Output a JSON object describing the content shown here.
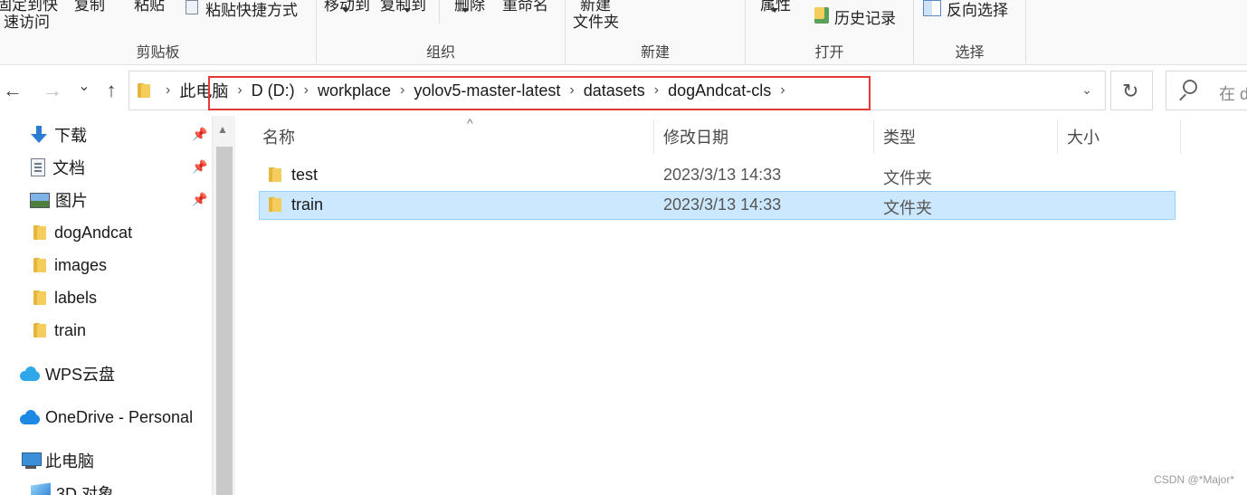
{
  "ribbon": {
    "clipboard": {
      "label": "剪贴板",
      "pin_quick_access_clipped": "固定到快",
      "quick_access_line2": "速访问",
      "copy_clipped": "复制",
      "paste_clipped": "粘贴",
      "paste_shortcut": "粘贴快捷方式"
    },
    "organize": {
      "label": "组织",
      "move_to_clipped": "移动到",
      "copy_to_clipped": "复制到",
      "delete_clipped": "删除",
      "rename_clipped": "重命名"
    },
    "new": {
      "label": "新建",
      "new_folder_line1_clipped": "新建",
      "new_folder_line2": "文件夹"
    },
    "open": {
      "label": "打开",
      "properties_clipped": "属性",
      "history": "历史记录"
    },
    "select": {
      "label": "选择",
      "invert_selection": "反向选择"
    }
  },
  "address": {
    "crumbs": [
      "此电脑",
      "D (D:)",
      "workplace",
      "yolov5-master-latest",
      "datasets",
      "dogAndcat-cls"
    ],
    "search_placeholder": "在 d"
  },
  "nav": {
    "back": "←",
    "forward": "→",
    "recent": "⌄",
    "up": "↑",
    "items": [
      {
        "label": "下载",
        "icon": "download-icon",
        "pinned": true
      },
      {
        "label": "文档",
        "icon": "document-icon",
        "pinned": true
      },
      {
        "label": "图片",
        "icon": "pictures-icon",
        "pinned": true
      },
      {
        "label": "dogAndcat",
        "icon": "folder-icon",
        "pinned": false
      },
      {
        "label": "images",
        "icon": "folder-icon",
        "pinned": false
      },
      {
        "label": "labels",
        "icon": "folder-icon",
        "pinned": false
      },
      {
        "label": "train",
        "icon": "folder-icon",
        "pinned": false
      },
      {
        "label": "WPS云盘",
        "icon": "wps-cloud-icon",
        "pinned": false
      },
      {
        "label": "OneDrive - Personal",
        "icon": "onedrive-cloud-icon",
        "pinned": false
      },
      {
        "label": "此电脑",
        "icon": "this-pc-icon",
        "pinned": false
      },
      {
        "label": "3D 对象",
        "icon": "3d-objects-icon",
        "pinned": false
      }
    ]
  },
  "filelist": {
    "columns": {
      "name": "名称",
      "modified": "修改日期",
      "type": "类型",
      "size": "大小"
    },
    "rows": [
      {
        "name": "test",
        "modified": "2023/3/13 14:33",
        "type": "文件夹",
        "size": "",
        "selected": false
      },
      {
        "name": "train",
        "modified": "2023/3/13 14:33",
        "type": "文件夹",
        "size": "",
        "selected": true
      }
    ]
  },
  "watermark": "CSDN @*Major*",
  "colors": {
    "selection_fill": "#cce8ff",
    "selection_border": "#99d1ff",
    "highlight_box": "#e53935",
    "folder_yellow": "#f5cd5c"
  }
}
